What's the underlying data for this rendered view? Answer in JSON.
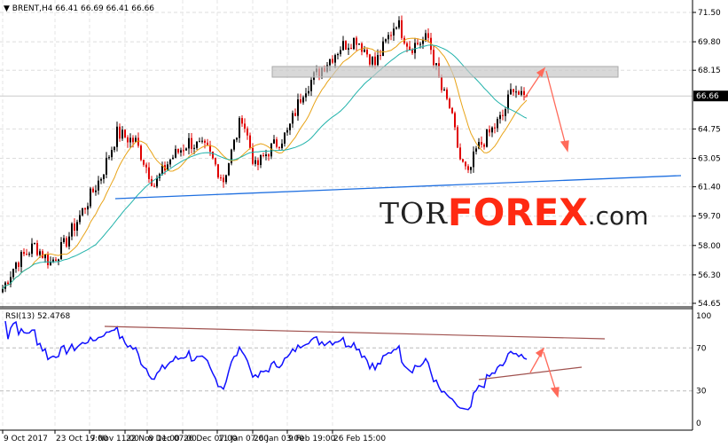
{
  "header": {
    "symbol_label": "BRENT,H4",
    "ohlc": "66.41 66.69 66.41 66.66",
    "menu_icon": "triangle-down-icon"
  },
  "price_axis": {
    "ticks": [
      "71.50",
      "69.80",
      "68.15",
      "64.75",
      "63.05",
      "61.40",
      "59.70",
      "58.00",
      "56.30",
      "54.65"
    ],
    "tick_values": [
      71.5,
      69.8,
      68.15,
      64.75,
      63.05,
      61.4,
      59.7,
      58.0,
      56.3,
      54.65
    ],
    "current_price": "66.66",
    "range": [
      54.65,
      71.5
    ]
  },
  "rsi": {
    "label": "RSI(13) 52.4768",
    "period": 13,
    "ticks": [
      "100",
      "70",
      "30",
      "0"
    ],
    "tick_values": [
      100,
      70,
      30,
      0
    ]
  },
  "time_axis": {
    "labels": [
      "9 Oct 2017",
      "23 Oct 19:00",
      "7 Nov 11:00",
      "22 Nov 11:00",
      "8 Dec 07:00",
      "26 Dec 07:00",
      "11 Jan 07:00",
      "26 Jan 03:00",
      "9 Feb 19:00",
      "26 Feb 15:00"
    ]
  },
  "price_path": [
    [
      0,
      55.5
    ],
    [
      5,
      57
    ],
    [
      12,
      58
    ],
    [
      18,
      57
    ],
    [
      23,
      58
    ],
    [
      30,
      60
    ],
    [
      37,
      62
    ],
    [
      43,
      64.5
    ],
    [
      50,
      64
    ],
    [
      57,
      61.5
    ],
    [
      63,
      63
    ],
    [
      70,
      64
    ],
    [
      77,
      63.5
    ],
    [
      83,
      61.8
    ],
    [
      90,
      65.5
    ],
    [
      95,
      62.5
    ],
    [
      100,
      63.5
    ],
    [
      107,
      64.5
    ],
    [
      113,
      67
    ],
    [
      120,
      68.3
    ],
    [
      127,
      69.5
    ],
    [
      133,
      70
    ],
    [
      140,
      68.5
    ],
    [
      148,
      71
    ],
    [
      153,
      69.5
    ],
    [
      160,
      70
    ],
    [
      165,
      67
    ],
    [
      168,
      66
    ],
    [
      172,
      63
    ],
    [
      175,
      62
    ],
    [
      178,
      63.5
    ],
    [
      183,
      64.5
    ],
    [
      188,
      65.5
    ],
    [
      192,
      67.3
    ],
    [
      195,
      66.5
    ],
    [
      197,
      66.66
    ]
  ],
  "logo": {
    "part1": "TOR",
    "part2": "FOREX",
    "part3": ".com"
  },
  "colors": {
    "bull": "#000000",
    "bear": "#e00000",
    "ma_fast": "#e8a317",
    "ma_slow": "#20b2aa",
    "trendline": "#1e6fe0",
    "rsi": "#1010ff",
    "rsi_lines": "#a0524f",
    "arrows": "#ff6a5a",
    "resistance_zone": "#c8c8c8",
    "logo_red": "#ff2a12"
  }
}
